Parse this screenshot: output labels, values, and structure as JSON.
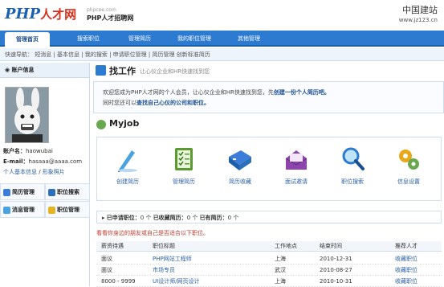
{
  "header": {
    "logo_latin": "PHP",
    "logo_cn": "人才网",
    "site_domain": "phpcee.com",
    "site_name": "PHP人才招聘网",
    "watermark_cn": "中国建站",
    "watermark_url": "www.jz123.cn"
  },
  "nav": {
    "tabs": [
      {
        "label": "管理首页",
        "active": true
      },
      {
        "label": "搜索职位",
        "active": false
      },
      {
        "label": "管理简历",
        "active": false
      },
      {
        "label": "我的职位管理",
        "active": false
      },
      {
        "label": "其他管理",
        "active": false
      }
    ]
  },
  "quicknav": {
    "label": "快速导航：",
    "links": [
      "短消息",
      "基本信息",
      "我的搜索",
      "申请职位管理",
      "简历管理",
      "创新标准简历"
    ]
  },
  "sidebar": {
    "title": "账户信息",
    "username_label": "账户名：",
    "username": "haowubai",
    "email_label": "E-mail：",
    "email": "hasaaa@aaaa.com",
    "link_profile": "个人基本信息",
    "link_photo": "形象照片",
    "buttons": [
      "简历管理",
      "职位搜索",
      "消息管理",
      "职位管理"
    ]
  },
  "find": {
    "title": "找工作",
    "desc": "让心仪企业和HR快速找到您"
  },
  "welcome": {
    "line1_pre": "欢迎您成为PHP人才网的个人会员，让心仪企业和HR快速找到您，先",
    "line1_link": "创建一份个人简历吧。",
    "line2_pre": "同时您还可以",
    "line2_link": "查找自己心仪的公司和职位。"
  },
  "myjob": {
    "title": "Myjob",
    "items": [
      {
        "label": "创建简历",
        "icon": "pen-icon"
      },
      {
        "label": "管理简历",
        "icon": "checklist-icon"
      },
      {
        "label": "简历收藏",
        "icon": "binder-icon"
      },
      {
        "label": "面试邀请",
        "icon": "envelope-icon"
      },
      {
        "label": "职位搜索",
        "icon": "magnifier-icon"
      },
      {
        "label": "信息设置",
        "icon": "gears-icon"
      }
    ]
  },
  "stats": {
    "applied_label": "已申请职位：",
    "applied": "0",
    "fav_label": "已收藏简历：",
    "fav": "0",
    "received_label": "已有简历：",
    "received": "0",
    "unit": "个"
  },
  "notice": "看看你身边的朋友或自己是否适合以下职位。",
  "table": {
    "headers": [
      "薪资待遇",
      "职位标题",
      "工作地点",
      "结束时间",
      "推荐人才"
    ],
    "rows": [
      [
        "面议",
        "PHP网站工程师",
        "上海",
        "2010-12-31",
        "收藏职位"
      ],
      [
        "面议",
        "市场专员",
        "武汉",
        "2010-08-27",
        "收藏职位"
      ],
      [
        "8000 - 9999",
        "UI设计师/网页设计",
        "上海",
        "2010-10-31",
        "收藏职位"
      ]
    ]
  },
  "colors": {
    "nav_bg": "#2d7bd0",
    "link": "#2a5fa3",
    "accent_red": "#c0392b"
  }
}
